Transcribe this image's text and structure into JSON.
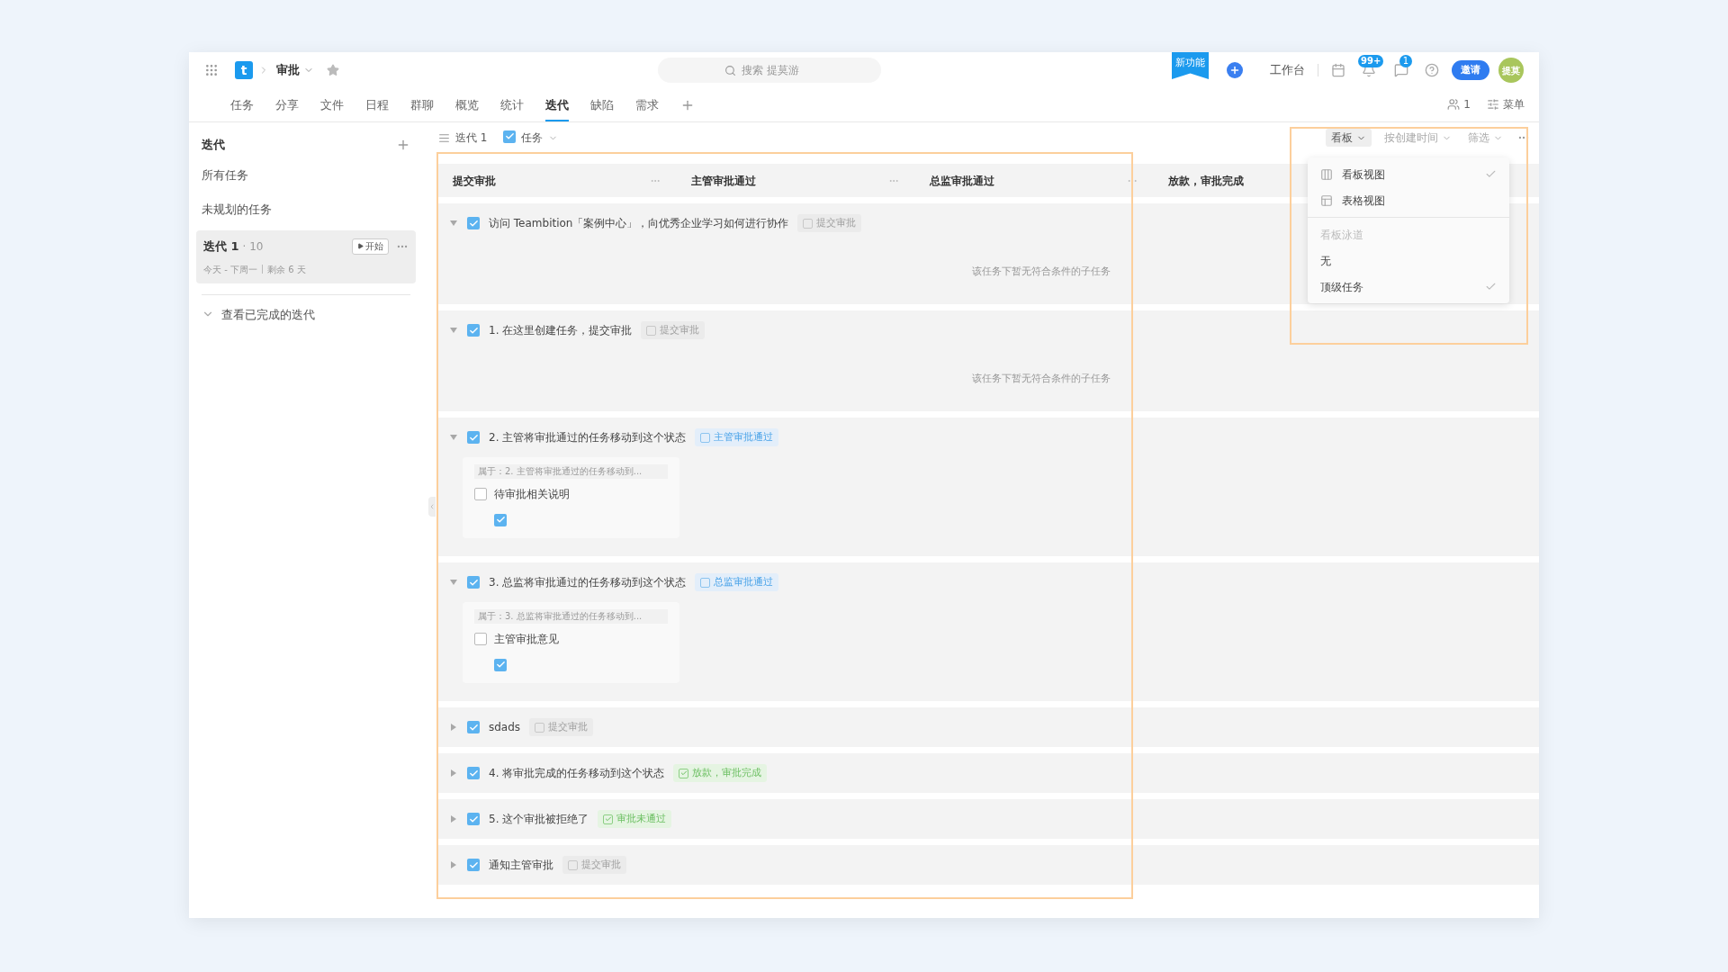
{
  "top_bar": {
    "logo": "t",
    "project": "审批",
    "search": {
      "placeholder": "搜索 提莫游"
    },
    "new_feature": "新功能",
    "workbench": "工作台",
    "notification_badge": "99+",
    "message_badge": "1",
    "invite": "邀请",
    "avatar": "提莫"
  },
  "tabs": [
    {
      "label": "任务",
      "selected": false
    },
    {
      "label": "分享",
      "selected": false
    },
    {
      "label": "文件",
      "selected": false
    },
    {
      "label": "日程",
      "selected": false
    },
    {
      "label": "群聊",
      "selected": false
    },
    {
      "label": "概览",
      "selected": false
    },
    {
      "label": "统计",
      "selected": false
    },
    {
      "label": "迭代",
      "selected": true
    },
    {
      "label": "缺陷",
      "selected": false
    },
    {
      "label": "需求",
      "selected": false
    }
  ],
  "tab_bar_right": {
    "members": "1",
    "menu": "菜单"
  },
  "sidebar": {
    "title": "迭代",
    "items": [
      {
        "label": "所有任务",
        "selected": false
      },
      {
        "label": "未规划的任务",
        "selected": false
      }
    ],
    "iteration": {
      "name": "迭代 1",
      "count": "· 10",
      "dates": "今天 - 下周一",
      "remaining": "剩余 6 天",
      "start": "开始",
      "selected": true
    },
    "completed": "查看已完成的迭代"
  },
  "toolbar": {
    "iteration": "迭代 1",
    "task_type": {
      "label": "任务",
      "checked": true
    },
    "view": "看板",
    "sort": "按创建时间",
    "filter": "筛选"
  },
  "columns": [
    "提交审批",
    "主管审批通过",
    "总监审批通过",
    "放款，审批完成"
  ],
  "lanes": [
    {
      "title": "访问 Teambition「案例中心」，向优秀企业学习如何进行协作",
      "checked": true,
      "expanded": true,
      "status": {
        "label": "提交审批",
        "kind": "default"
      },
      "empty_note": "该任务下暂无符合条件的子任务"
    },
    {
      "title": "1. 在这里创建任务，提交审批",
      "checked": true,
      "expanded": true,
      "status": {
        "label": "提交审批",
        "kind": "default"
      },
      "empty_note": "该任务下暂无符合条件的子任务"
    },
    {
      "title": "2. 主管将审批通过的任务移动到这个状态",
      "checked": true,
      "expanded": true,
      "status": {
        "label": "主管审批通过",
        "kind": "blue"
      },
      "subtasks": [
        {
          "parent": "属于：2. 主管将审批通过的任务移动到...",
          "title": "待审批相关说明",
          "checked": false,
          "type_checked": true
        }
      ]
    },
    {
      "title": "3. 总监将审批通过的任务移动到这个状态",
      "checked": true,
      "expanded": true,
      "status": {
        "label": "总监审批通过",
        "kind": "blue"
      },
      "subtasks": [
        {
          "parent": "属于：3. 总监将审批通过的任务移动到...",
          "title": "主管审批意见",
          "checked": false,
          "type_checked": true
        }
      ]
    },
    {
      "title": "sdads",
      "checked": true,
      "expanded": false,
      "status": {
        "label": "提交审批",
        "kind": "default"
      }
    },
    {
      "title": "4. 将审批完成的任务移动到这个状态",
      "checked": true,
      "expanded": false,
      "status": {
        "label": "放款，审批完成",
        "kind": "green"
      }
    },
    {
      "title": "5. 这个审批被拒绝了",
      "checked": true,
      "expanded": false,
      "status": {
        "label": "审批未通过",
        "kind": "green"
      }
    },
    {
      "title": "通知主管审批",
      "checked": true,
      "expanded": false,
      "status": {
        "label": "提交审批",
        "kind": "default"
      }
    }
  ],
  "view_menu": {
    "views": [
      {
        "label": "看板视图",
        "kind": "board",
        "checked": true
      },
      {
        "label": "表格视图",
        "kind": "table",
        "checked": false
      }
    ],
    "swimlane_title": "看板泳道",
    "swimlanes": [
      {
        "label": "无",
        "checked": false
      },
      {
        "label": "顶级任务",
        "checked": true
      }
    ]
  }
}
